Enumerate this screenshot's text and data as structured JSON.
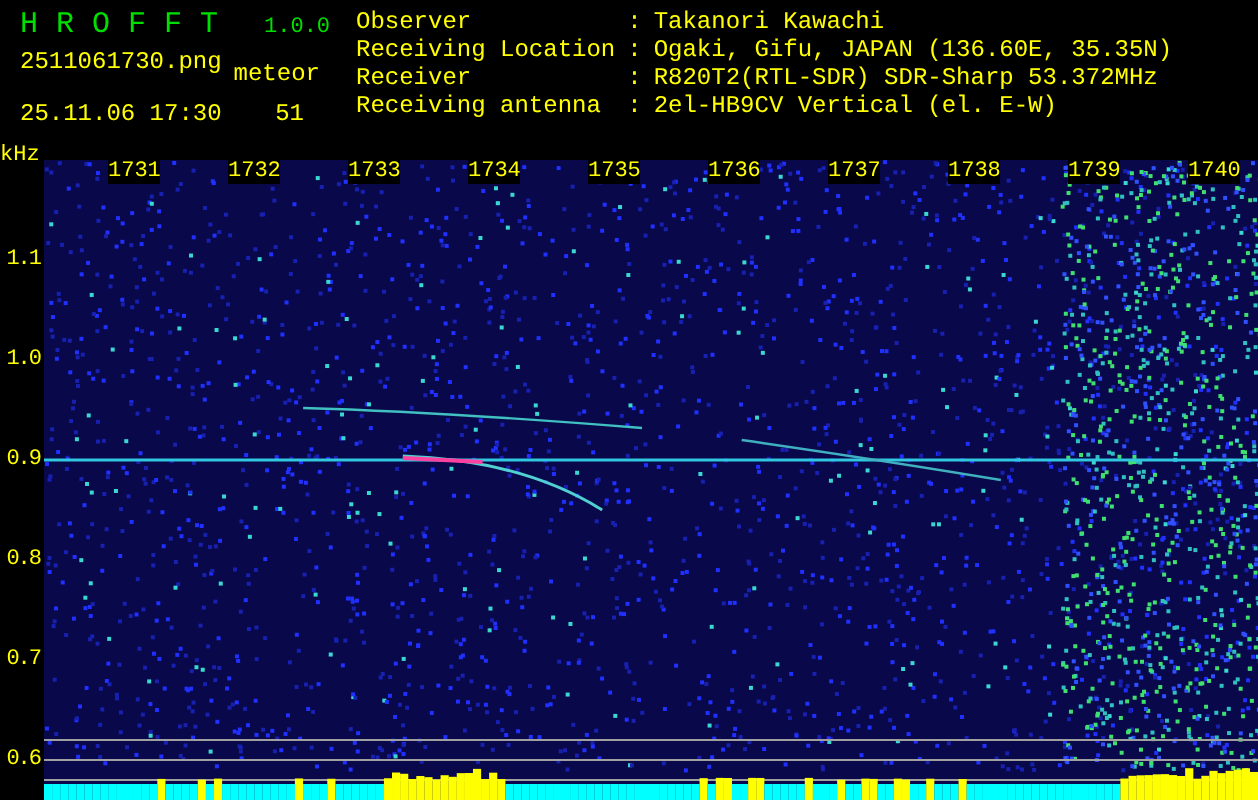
{
  "app": {
    "name": "HROFFT",
    "version": "1.0.0",
    "filename": "2511061730.png",
    "date": "25.11.06 17:30",
    "count_label": "meteor",
    "count": "51"
  },
  "info": [
    {
      "label": "Observer",
      "sep": ":",
      "value": "Takanori Kawachi"
    },
    {
      "label": "Receiving Location",
      "sep": ":",
      "value": "Ogaki, Gifu, JAPAN (136.60E, 35.35N)"
    },
    {
      "label": "Receiver",
      "sep": ":",
      "value": "R820T2(RTL-SDR) SDR-Sharp 53.372MHz"
    },
    {
      "label": "Receiving antenna",
      "sep": ":",
      "value": "2el-HB9CV Vertical (el. E-W)"
    }
  ],
  "plot": {
    "unit": "kHz",
    "x_labels": [
      "1731",
      "1732",
      "1733",
      "1734",
      "1735",
      "1736",
      "1737",
      "1738",
      "1739",
      "1740"
    ],
    "y_labels": [
      "1.1",
      "1.0",
      "0.9",
      "0.8",
      "0.7",
      "0.6"
    ]
  }
}
